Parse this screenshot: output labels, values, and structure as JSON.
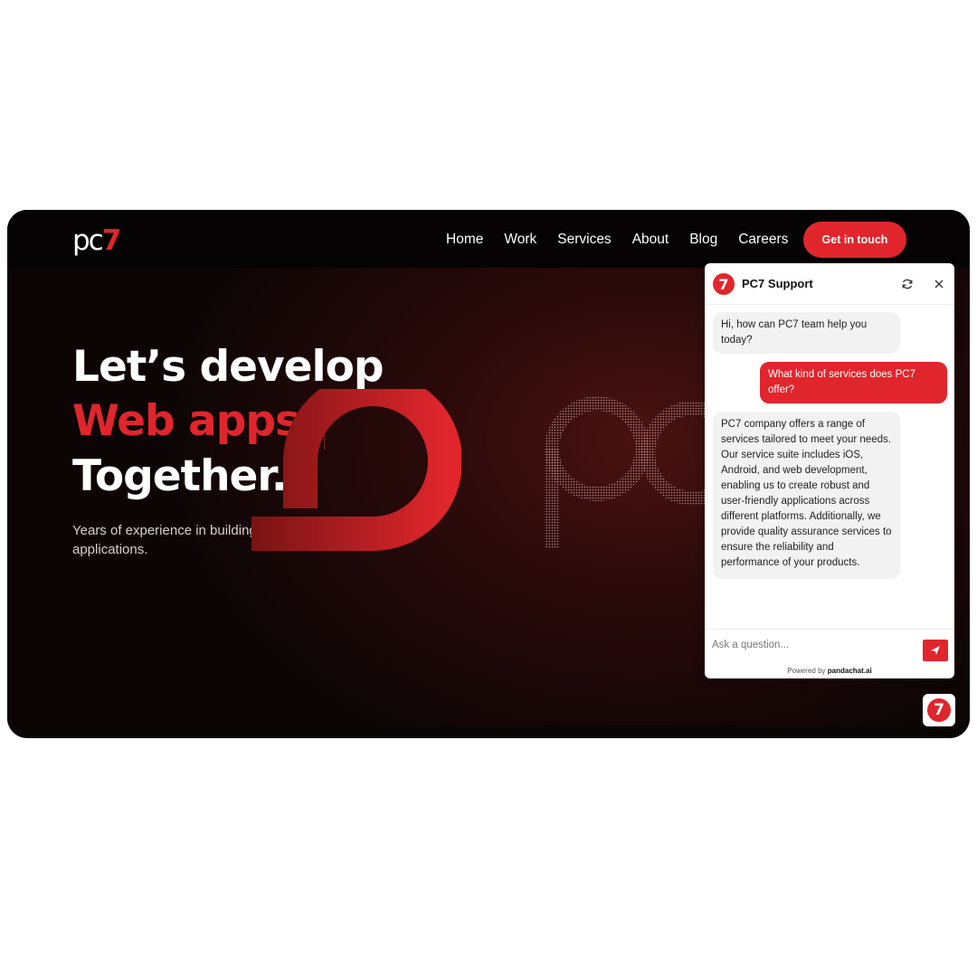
{
  "brand": {
    "logo_left": "pc",
    "logo_right": "7"
  },
  "nav": {
    "links": [
      "Home",
      "Work",
      "Services",
      "About",
      "Blog",
      "Careers"
    ],
    "cta_label": "Get in touch"
  },
  "hero": {
    "line1": "Let’s develop",
    "line2_highlight": "Web apps",
    "line2_end": ".",
    "line3": "Together.",
    "subtitle": "Years of experience in building amazing web & mobile applications."
  },
  "chat": {
    "avatar": "7",
    "title": "PC7 Support",
    "messages": [
      {
        "role": "bot",
        "text": "Hi, how can PC7 team help you today?"
      },
      {
        "role": "user",
        "text": "What kind of services does PC7 offer?"
      },
      {
        "role": "bot",
        "text": "PC7 company offers a  range of services tailored to meet your needs. Our service suite includes iOS, Android, and web development, enabling us to create robust and user-friendly applications across different platforms. Additionally, we provide quality assurance services to ensure the reliability and performance of your products."
      }
    ],
    "input_placeholder": "Ask a question...",
    "powered_prefix": "Powered by",
    "powered_brand": "pandachat.ai",
    "launcher": "7"
  },
  "colors": {
    "accent": "#e0262c",
    "nav_bg": "#050303",
    "hero_dark": "#0d0505"
  },
  "icons": {
    "refresh": "refresh-icon",
    "close": "close-icon",
    "send": "send-icon"
  }
}
